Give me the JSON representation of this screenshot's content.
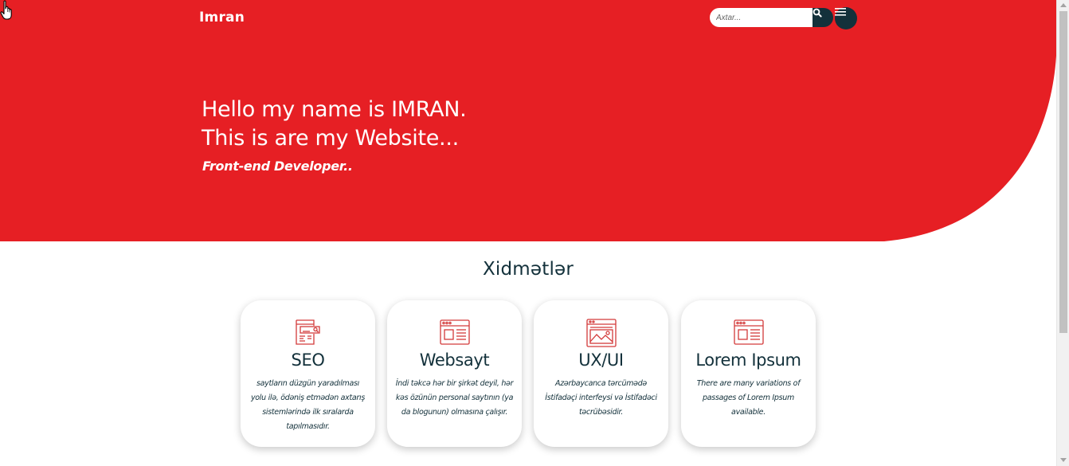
{
  "colors": {
    "accent": "#e61f24",
    "dark": "#13313b",
    "background": "#ffffff"
  },
  "header": {
    "logo": "Imran",
    "search": {
      "placeholder": "Axtar...",
      "icon": "search-icon"
    },
    "menu_icon": "hamburger-menu-icon"
  },
  "hero": {
    "line1": "Hello my name is IMRAN.",
    "line2": "This is are my Website...",
    "subtitle": "Front-end Developer.."
  },
  "services": {
    "title": "Xidmətlər",
    "items": [
      {
        "icon": "seo-icon",
        "title": "SEO",
        "text": "saytların düzgün yaradılması yolu ilə, ödəniş etmədən axtarış sistemlərində ilk sıralarda tapılmasıdır."
      },
      {
        "icon": "website-icon",
        "title": "Websayt",
        "text": "İndi təkcə hər bir şirkət deyil, hər kəs özünün personal saytının (ya da blogunun) olmasına çalışır."
      },
      {
        "icon": "ux-ui-icon",
        "title": "UX/UI",
        "text": "Azərbaycanca tərcümədə İstifadəçi interfeysi və İstifadəci təcrübəsidir."
      },
      {
        "icon": "website-icon",
        "title": "Lorem Ipsum",
        "text": "There are many variations of passages of Lorem Ipsum available."
      }
    ]
  }
}
